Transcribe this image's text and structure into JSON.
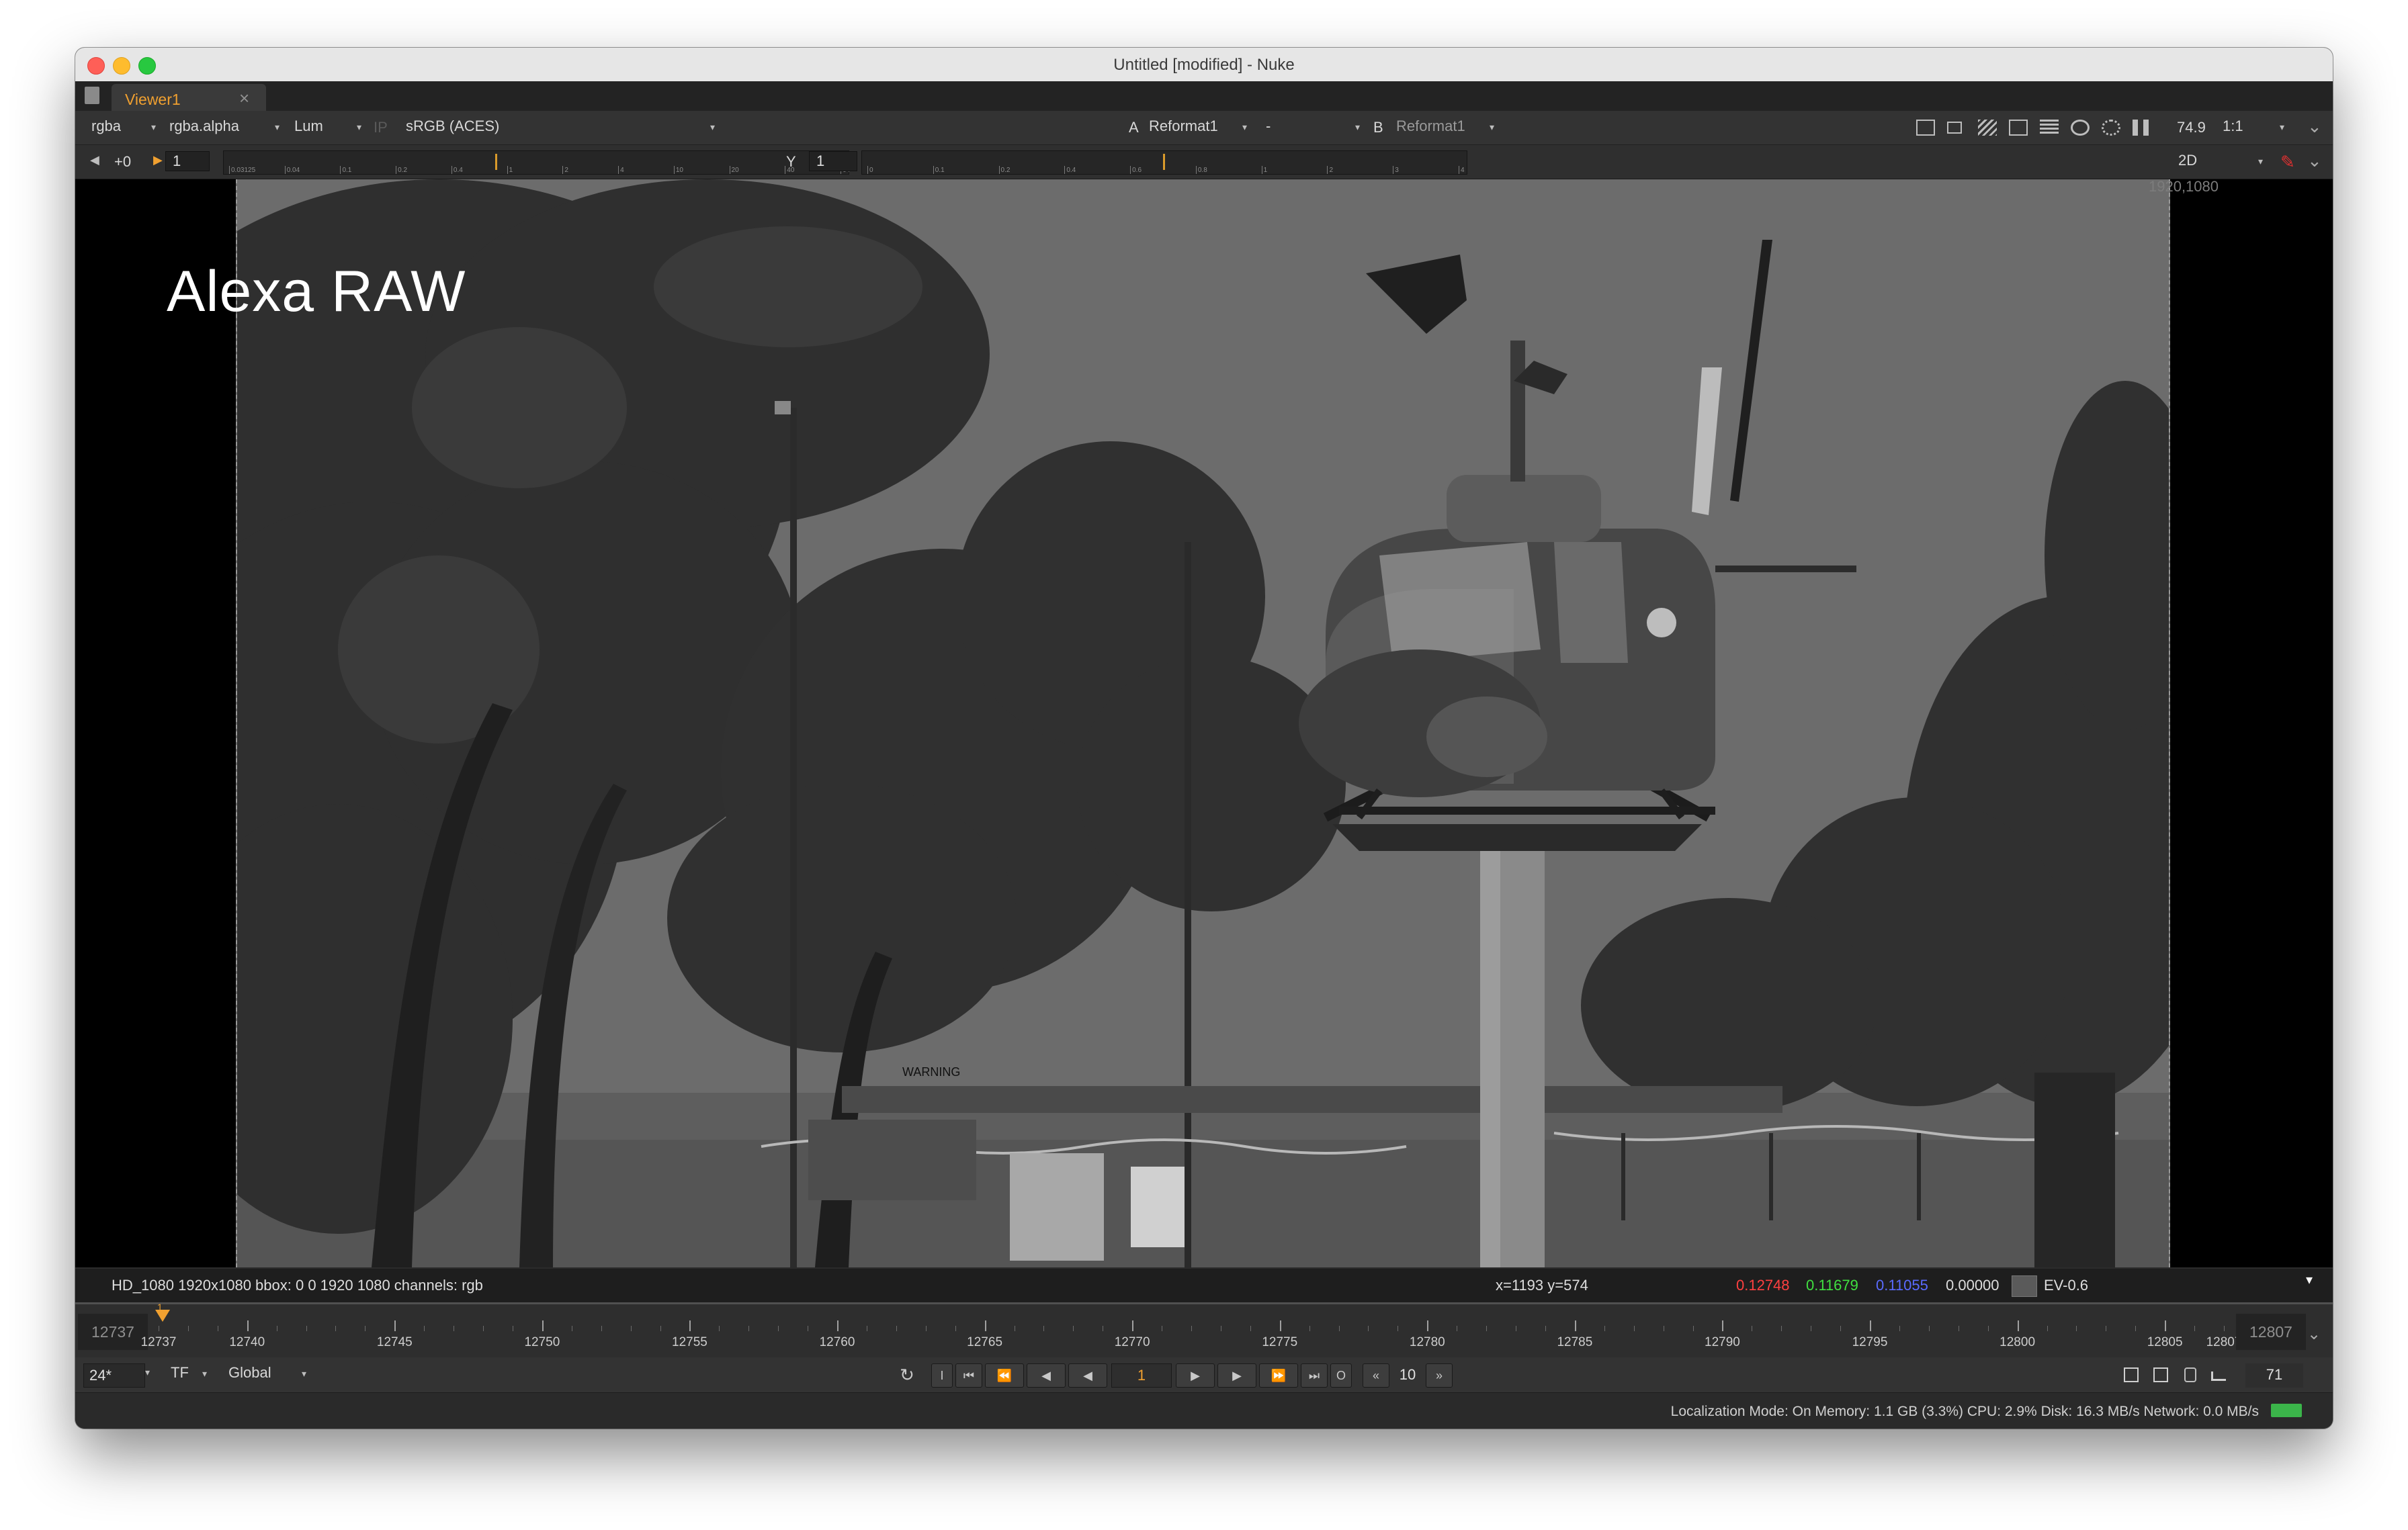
{
  "window": {
    "title": "Untitled [modified] - Nuke"
  },
  "tab": {
    "label": "Viewer1",
    "close": "×"
  },
  "toolbar": {
    "channels": "rgba",
    "alpha_channel": "rgba.alpha",
    "display_mode": "Lum",
    "ip": "IP",
    "colorspace": "sRGB (ACES)",
    "a_label": "A",
    "a_input": "Reformat1",
    "operation": "-",
    "b_label": "B",
    "b_input": "Reformat1",
    "zoom": "74.9",
    "proxy": "1:1"
  },
  "gain_row": {
    "gain_offset": "+0",
    "gain_value": "1",
    "gamma_label": "Y",
    "gamma_value": "1",
    "view_mode": "2D",
    "gain_ticks": [
      "0.03125",
      "0.04",
      "0.1",
      "0.2",
      "0.4",
      "1",
      "2",
      "4",
      "10",
      "20",
      "40",
      "64"
    ],
    "gamma_ticks": [
      "0",
      "0.1",
      "0.2",
      "0.4",
      "0.6",
      "0.8",
      "1",
      "2",
      "3",
      "4"
    ]
  },
  "viewer": {
    "overlay_label": "Alexa RAW",
    "format_corner": "1920,1080",
    "warning_sign": "WARNING"
  },
  "info": {
    "format": "HD_1080 1920x1080  bbox: 0 0 1920 1080 channels: rgb",
    "coords": "x=1193 y=574",
    "r": "0.12748",
    "g": "0.11679",
    "b": "0.11055",
    "a": "0.00000",
    "ev": "EV-0.6",
    "colors": {
      "r": "#ff4040",
      "g": "#40e040",
      "b": "#5a6bff"
    }
  },
  "timeline": {
    "start": "12737",
    "end": "12807",
    "playhead_label": "1",
    "labels": [
      "12737",
      "12740",
      "12745",
      "12750",
      "12755",
      "12760",
      "12765",
      "12770",
      "12775",
      "12780",
      "12785",
      "12790",
      "12795",
      "12800",
      "12805",
      "12807"
    ]
  },
  "playback": {
    "fps": "24*",
    "tf": "TF",
    "scope": "Global",
    "current_frame": "1",
    "increment": "10",
    "frame_count": "71",
    "in_label": "I",
    "out_label": "O"
  },
  "status": {
    "text": "Localization Mode: On  Memory: 1.1 GB (3.3%)  CPU: 2.9%  Disk: 16.3 MB/s  Network: 0.0 MB/s",
    "ok_color": "#3bb54a"
  },
  "icons": {
    "menu": "≡",
    "dropdown": "▾",
    "gain_left": "◀",
    "gain_right": "▶",
    "collapse": "⌄",
    "paint": "✎",
    "first_frame": "⏮",
    "prev_keyframe": "⏪",
    "prev_frame": "◀",
    "play_back": "◀",
    "play_forward": "▶",
    "next_frame": "▶",
    "next_keyframe": "⏩",
    "last_frame": "⏭",
    "skip_back": "«",
    "skip_forward": "»",
    "loop": "↻"
  }
}
